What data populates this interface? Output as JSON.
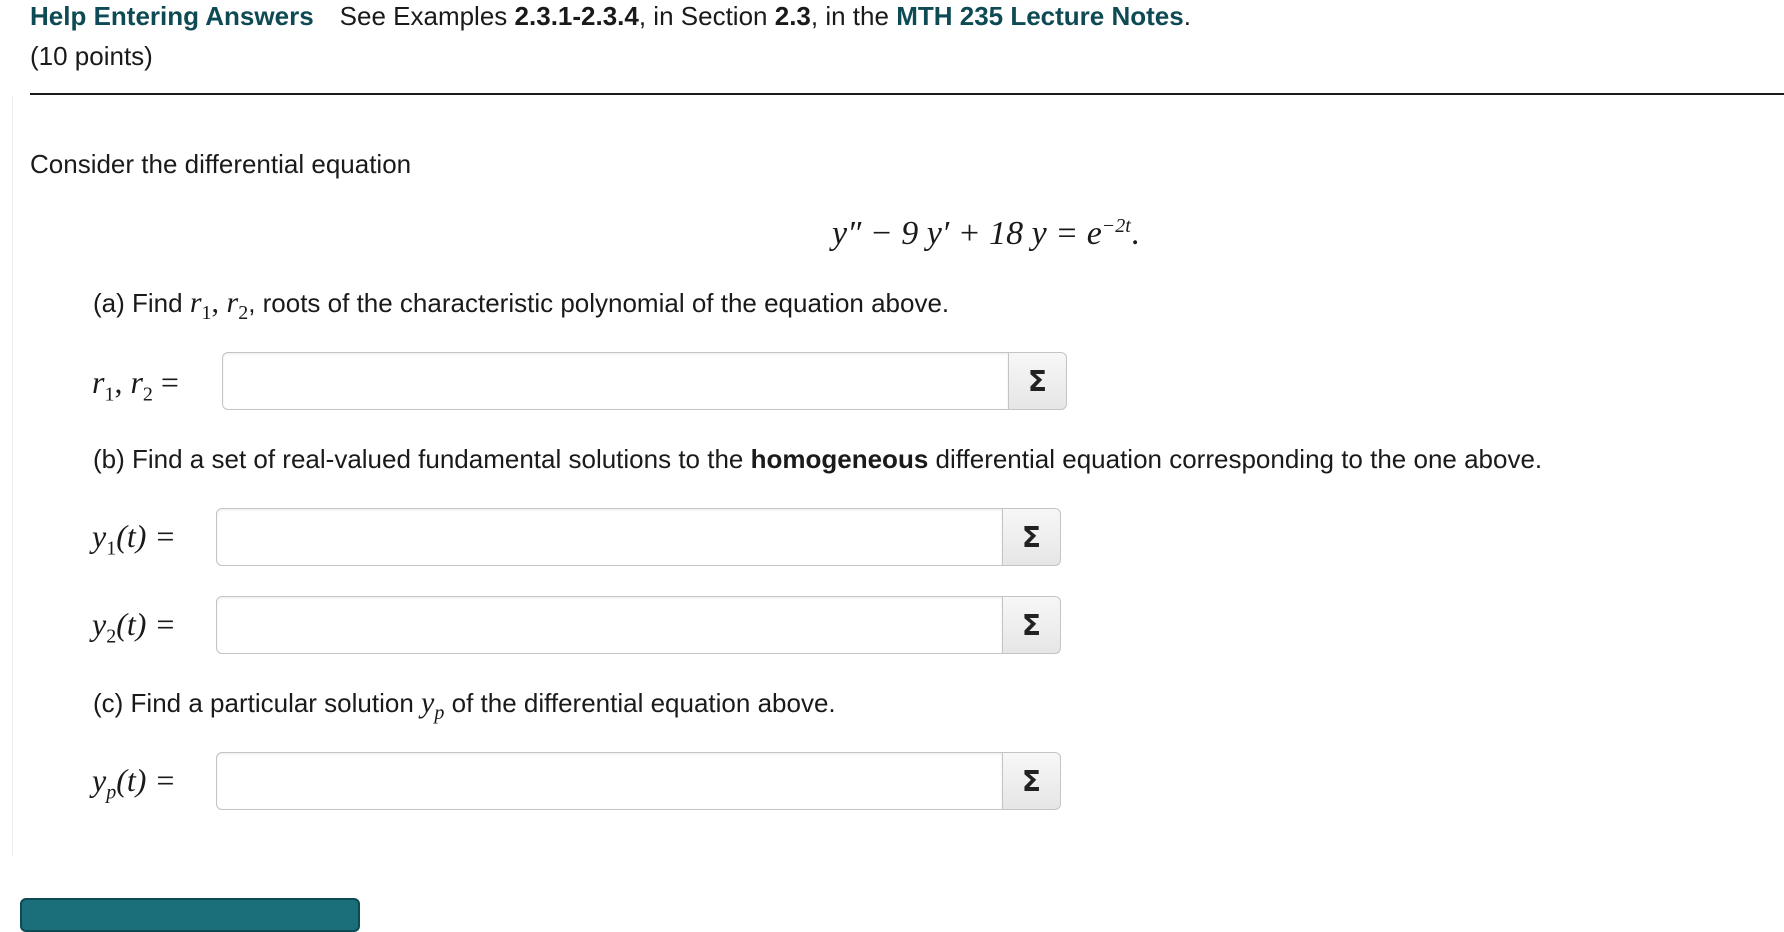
{
  "header": {
    "help_link": "Help Entering Answers",
    "see": "See Examples",
    "examples": "2.3.1-2.3.4",
    "in_section": ", in Section",
    "section": "2.3",
    "in_the": ", in the",
    "notes_link": "MTH 235 Lecture Notes",
    "period": ".",
    "points": "(10 points)"
  },
  "intro": "Consider the differential equation",
  "equation": {
    "lhs": "y″ − 9 y′ + 18 y = e",
    "exponent": "−2t",
    "end": "."
  },
  "part_a": {
    "prefix": "(a) Find",
    "r": "r",
    "sub1": "1",
    "comma": ", ",
    "sub2": "2",
    "suffix": ", roots of the characteristic polynomial of the equation above.",
    "label_r": "r",
    "label_sub1": "1",
    "label_sub2": "2",
    "label_eq": " =",
    "input_value": ""
  },
  "part_b": {
    "prefix": "(b) Find a set of real-valued fundamental solutions to the",
    "bold": "homogeneous",
    "suffix": "differential equation corresponding to the one above.",
    "y": "y",
    "sub1": "1",
    "sub2": "2",
    "arg": "(t) =",
    "input1_value": "",
    "input2_value": ""
  },
  "part_c": {
    "prefix": "(c) Find a particular solution",
    "y": "y",
    "sub": "p",
    "suffix": "of the differential equation above.",
    "label_y": "y",
    "label_sub": "p",
    "arg": "(t) =",
    "input_value": ""
  },
  "sigma_label": "Σ",
  "icons": {
    "equation_editor": "sigma-icon"
  }
}
